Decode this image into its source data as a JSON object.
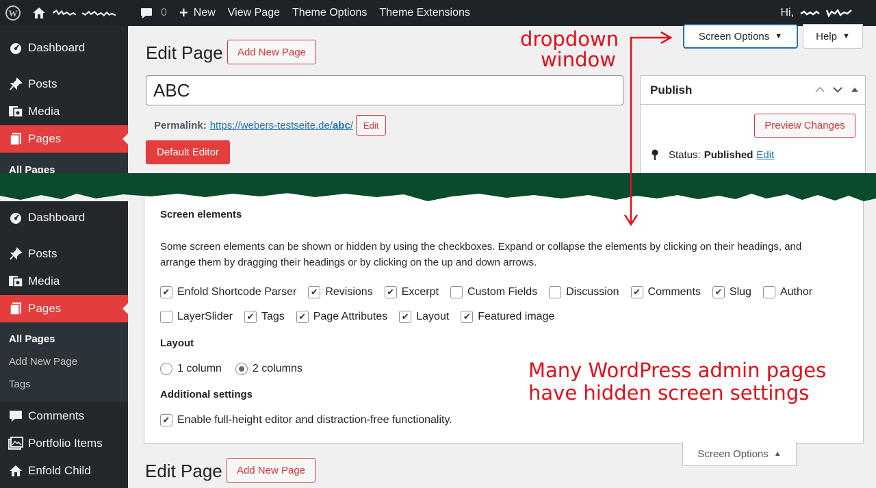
{
  "admin_bar": {
    "comment_count": "0",
    "new_label": "New",
    "view_page": "View Page",
    "theme_options": "Theme Options",
    "theme_extensions": "Theme Extensions",
    "greeting": "Hi,"
  },
  "sidebar_top": {
    "items": [
      {
        "label": "Dashboard",
        "icon": "dashboard-icon"
      },
      {
        "label": "Posts",
        "icon": "pin-icon"
      },
      {
        "label": "Media",
        "icon": "media-icon"
      },
      {
        "label": "Pages",
        "icon": "pages-icon"
      }
    ],
    "sub_current": "All Pages"
  },
  "sidebar_bottom": {
    "items": [
      {
        "label": "Dashboard",
        "icon": "dashboard-icon"
      },
      {
        "label": "Posts",
        "icon": "pin-icon"
      },
      {
        "label": "Media",
        "icon": "media-icon"
      },
      {
        "label": "Pages",
        "icon": "pages-icon"
      }
    ],
    "subitems": [
      "All Pages",
      "Add New Page",
      "Tags"
    ],
    "after": [
      {
        "label": "Comments",
        "icon": "comment-icon"
      },
      {
        "label": "Portfolio Items",
        "icon": "portfolio-icon"
      },
      {
        "label": "Enfold Child",
        "icon": "theme-icon"
      }
    ]
  },
  "editor": {
    "heading": "Edit Page",
    "add_new": "Add New Page",
    "title_value": "ABC",
    "permalink_label": "Permalink:",
    "permalink_base": "https://webers-testseite.de/",
    "permalink_slug": "abc",
    "permalink_end": "/",
    "edit_label": "Edit",
    "default_editor": "Default Editor"
  },
  "tabs": {
    "screen_options": "Screen Options",
    "help": "Help"
  },
  "publish": {
    "title": "Publish",
    "preview": "Preview Changes",
    "status_label": "Status:",
    "status_value": "Published",
    "status_edit": "Edit"
  },
  "screen_options_panel": {
    "elements_heading": "Screen elements",
    "description_1": "Some screen elements can be shown or hidden by using the checkboxes. Expand or collapse the elements by clicking on their headings, and",
    "description_2": "arrange them by dragging their headings or by clicking on the up and down arrows.",
    "row1": [
      {
        "label": "Enfold Shortcode Parser",
        "checked": true
      },
      {
        "label": "Revisions",
        "checked": true
      },
      {
        "label": "Excerpt",
        "checked": true
      },
      {
        "label": "Custom Fields",
        "checked": false
      },
      {
        "label": "Discussion",
        "checked": false
      },
      {
        "label": "Comments",
        "checked": true
      },
      {
        "label": "Slug",
        "checked": true
      },
      {
        "label": "Author",
        "checked": false
      }
    ],
    "row2": [
      {
        "label": "LayerSlider",
        "checked": false
      },
      {
        "label": "Tags",
        "checked": true
      },
      {
        "label": "Page Attributes",
        "checked": true
      },
      {
        "label": "Layout",
        "checked": true
      },
      {
        "label": "Featured image",
        "checked": true
      }
    ],
    "layout_heading": "Layout",
    "layout_options": [
      {
        "label": "1 column",
        "selected": false
      },
      {
        "label": "2 columns",
        "selected": true
      }
    ],
    "additional_heading": "Additional settings",
    "additional_option": {
      "label": "Enable full-height editor and distraction-free functionality.",
      "checked": true
    }
  },
  "bottom": {
    "screen_options": "Screen Options",
    "heading": "Edit Page",
    "add_new": "Add New Page"
  },
  "annotations": {
    "dropdown_1": "dropdown",
    "dropdown_2": "window",
    "note_1": "Many WordPress admin pages",
    "note_2": "have hidden screen settings"
  },
  "colors": {
    "admin_bar": "#1d2327",
    "sidebar": "#23282d",
    "accent_red": "#e33d3d",
    "link_blue": "#2271b1",
    "annotation_red": "#e0101a",
    "tear_green": "#0b4a2c"
  }
}
